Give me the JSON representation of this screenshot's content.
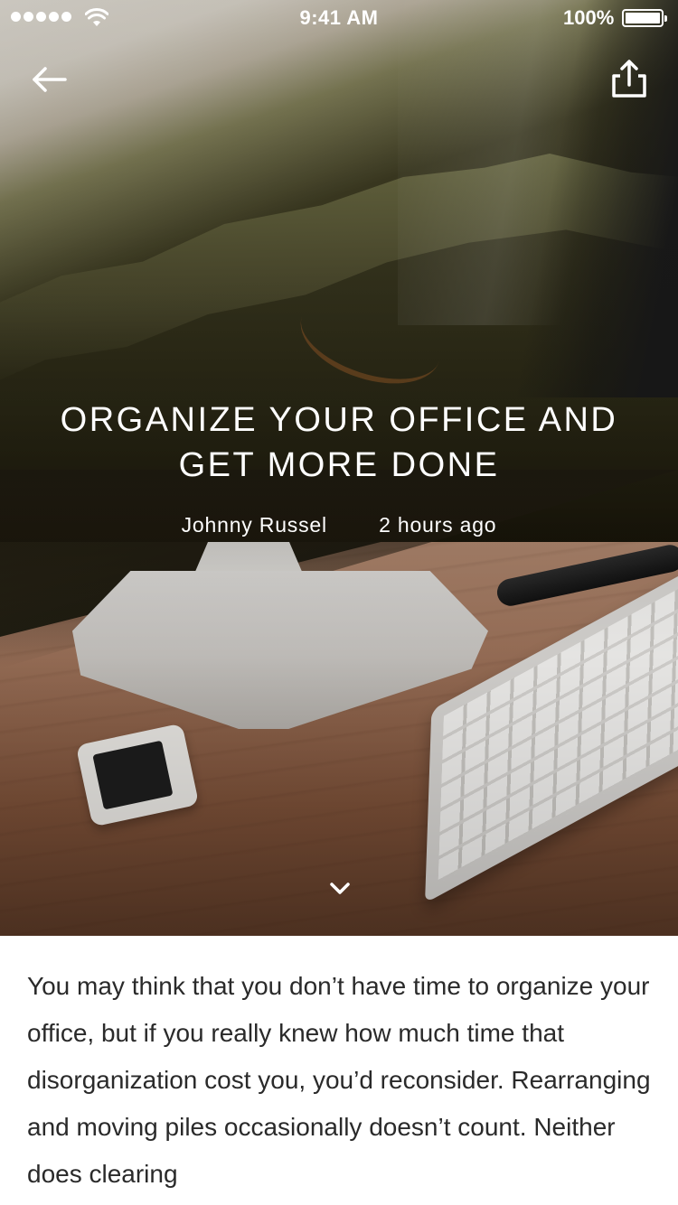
{
  "status_bar": {
    "time": "9:41 AM",
    "battery_percent": "100%",
    "icons": [
      "signal-dots-icon",
      "wifi-icon",
      "battery-icon"
    ]
  },
  "nav": {
    "back_icon": "arrow-left-icon",
    "share_icon": "share-icon"
  },
  "hero": {
    "title": "ORGANIZE YOUR OFFICE AND GET MORE DONE",
    "author": "Johnny Russel",
    "time_ago": "2 hours ago",
    "scroll_icon": "chevron-down-icon"
  },
  "article": {
    "body": "You may think that you don’t have time to organize your office, but if you really knew how much time that disorganization cost you, you’d reconsider. Rearranging and moving piles occasionally doesn’t count. Neither does clearing"
  },
  "colors": {
    "text_light": "#ffffff",
    "body_text": "#2a2a2a",
    "background": "#ffffff"
  }
}
